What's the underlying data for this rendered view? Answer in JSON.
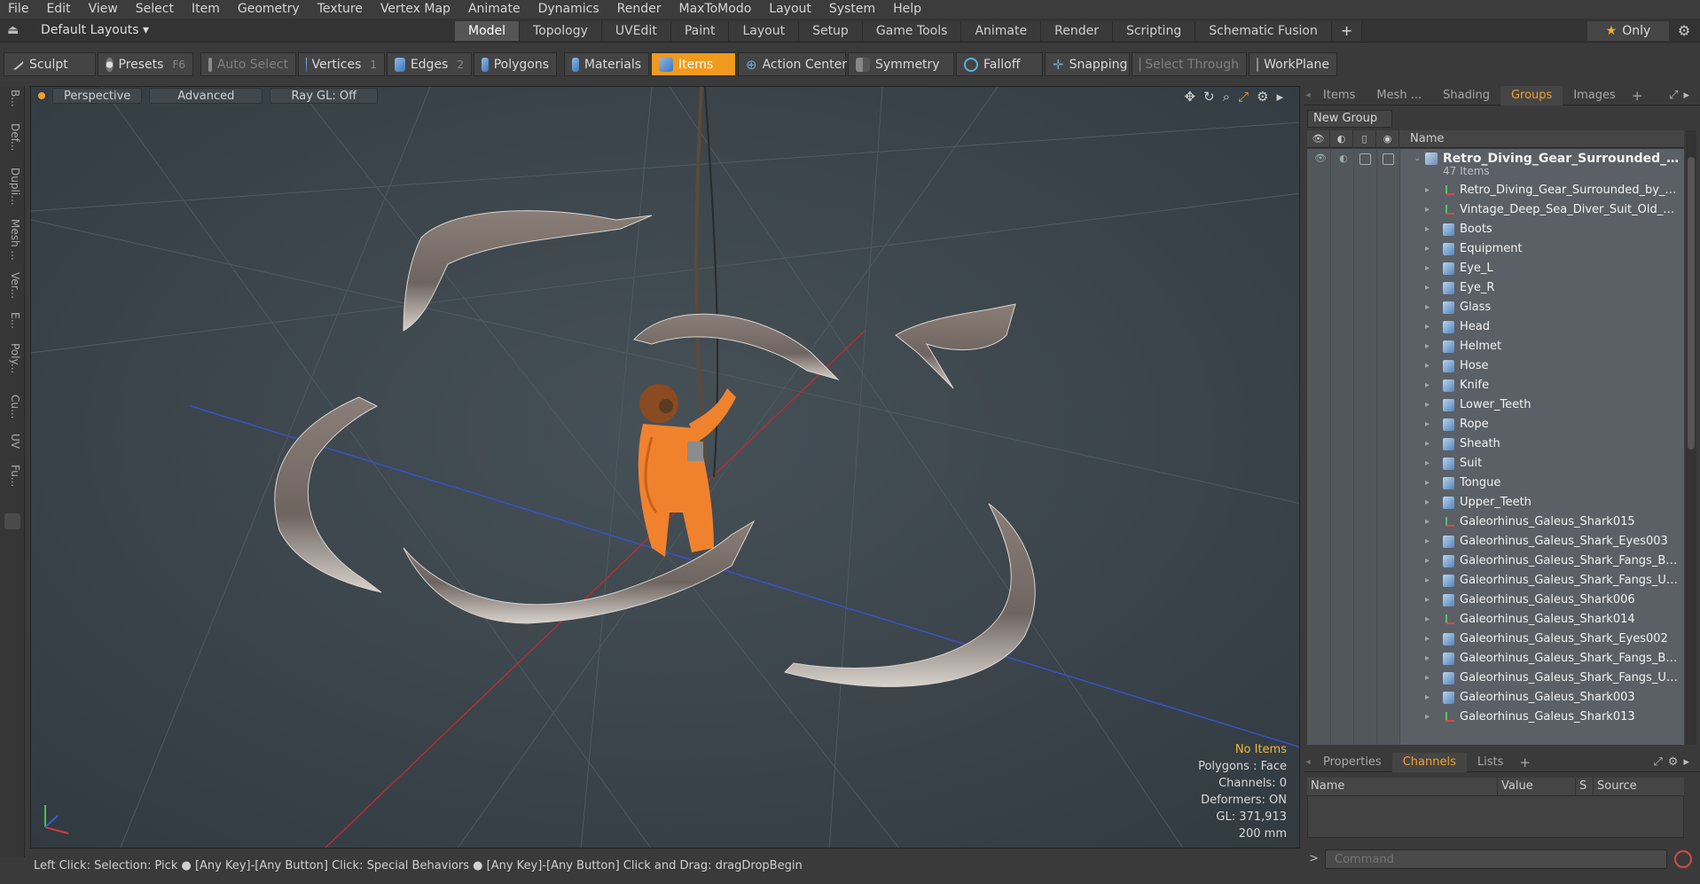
{
  "menu": [
    "File",
    "Edit",
    "View",
    "Select",
    "Item",
    "Geometry",
    "Texture",
    "Vertex Map",
    "Animate",
    "Dynamics",
    "Render",
    "MaxToModo",
    "Layout",
    "System",
    "Help"
  ],
  "layout_bar": {
    "layouts_label": "Default Layouts ▾",
    "tabs": [
      "Model",
      "Topology",
      "UVEdit",
      "Paint",
      "Layout",
      "Setup",
      "Game Tools",
      "Animate",
      "Render",
      "Scripting",
      "Schematic Fusion",
      "+"
    ],
    "active_tab": "Model",
    "only_label": "Only"
  },
  "toolbar": {
    "sculpt": "Sculpt",
    "presets": "Presets",
    "presets_key": "F6",
    "auto_select": "Auto Select",
    "vertices": "Vertices",
    "vertices_key": "1",
    "edges": "Edges",
    "edges_key": "2",
    "polygons": "Polygons",
    "materials": "Materials",
    "items": "Items",
    "action_center": "Action Center",
    "symmetry": "Symmetry",
    "falloff": "Falloff",
    "snapping": "Snapping",
    "select_through": "Select Through",
    "workplane": "WorkPlane"
  },
  "left_tabs": [
    "B...",
    "Def...",
    "Dupli...",
    "Mesh ...",
    "Ver...",
    "E...",
    "Poly...",
    "Cu...",
    "UV",
    "Fu..."
  ],
  "viewport": {
    "view": "Perspective",
    "shading": "Advanced",
    "raygl": "Ray GL: Off",
    "info": {
      "selection": "No Items",
      "polygons": "Polygons : Face",
      "channels": "Channels: 0",
      "deformers": "Deformers: ON",
      "gl": "GL: 371,913",
      "unit": "200 mm"
    }
  },
  "status_bar": "Left Click: Selection: Pick ● [Any Key]-[Any Button] Click: Special Behaviors ● [Any Key]-[Any Button] Click and Drag: dragDropBegin",
  "right_panel": {
    "tabs": [
      "Items",
      "Mesh ...",
      "Shading",
      "Groups",
      "Images",
      "+"
    ],
    "active_tab": "Groups",
    "new_group": "New Group",
    "column_name": "Name",
    "group": {
      "name": "Retro_Diving_Gear_Surrounded_b...",
      "count": "47 Items"
    },
    "items": [
      {
        "name": "Retro_Diving_Gear_Surrounded_by_S...",
        "icon": "locator-icon"
      },
      {
        "name": "Vintage_Deep_Sea_Diver_Suit_Old_S ...",
        "icon": "locator-icon"
      },
      {
        "name": "Boots",
        "icon": "mesh-icon"
      },
      {
        "name": "Equipment",
        "icon": "mesh-icon"
      },
      {
        "name": "Eye_L",
        "icon": "mesh-icon"
      },
      {
        "name": "Eye_R",
        "icon": "mesh-icon"
      },
      {
        "name": "Glass",
        "icon": "mesh-icon"
      },
      {
        "name": "Head",
        "icon": "mesh-icon"
      },
      {
        "name": "Helmet",
        "icon": "mesh-icon"
      },
      {
        "name": "Hose",
        "icon": "mesh-icon"
      },
      {
        "name": "Knife",
        "icon": "mesh-icon"
      },
      {
        "name": "Lower_Teeth",
        "icon": "mesh-icon"
      },
      {
        "name": "Rope",
        "icon": "mesh-icon"
      },
      {
        "name": "Sheath",
        "icon": "mesh-icon"
      },
      {
        "name": "Suit",
        "icon": "mesh-icon"
      },
      {
        "name": "Tongue",
        "icon": "mesh-icon"
      },
      {
        "name": "Upper_Teeth",
        "icon": "mesh-icon"
      },
      {
        "name": "Galeorhinus_Galeus_Shark015",
        "icon": "locator-icon"
      },
      {
        "name": "Galeorhinus_Galeus_Shark_Eyes003",
        "icon": "mesh-icon"
      },
      {
        "name": "Galeorhinus_Galeus_Shark_Fangs_Bot ...",
        "icon": "mesh-icon"
      },
      {
        "name": "Galeorhinus_Galeus_Shark_Fangs_Up ...",
        "icon": "mesh-icon"
      },
      {
        "name": "Galeorhinus_Galeus_Shark006",
        "icon": "mesh-icon"
      },
      {
        "name": "Galeorhinus_Galeus_Shark014",
        "icon": "locator-icon"
      },
      {
        "name": "Galeorhinus_Galeus_Shark_Eyes002",
        "icon": "mesh-icon"
      },
      {
        "name": "Galeorhinus_Galeus_Shark_Fangs_Bot ...",
        "icon": "mesh-icon"
      },
      {
        "name": "Galeorhinus_Galeus_Shark_Fangs_Up ...",
        "icon": "mesh-icon"
      },
      {
        "name": "Galeorhinus_Galeus_Shark003",
        "icon": "mesh-icon"
      },
      {
        "name": "Galeorhinus_Galeus_Shark013",
        "icon": "locator-icon"
      }
    ],
    "bottom_tabs": [
      "Properties",
      "Channels",
      "Lists",
      "+"
    ],
    "bottom_active": "Channels",
    "channel_columns": [
      "Name",
      "Value",
      "S",
      "Source"
    ],
    "command_prompt": ">",
    "command_placeholder": "Command"
  },
  "colors": {
    "accent": "#f09a1e",
    "viewport_bg": "#3a4248",
    "list_bg": "#5b6066"
  }
}
